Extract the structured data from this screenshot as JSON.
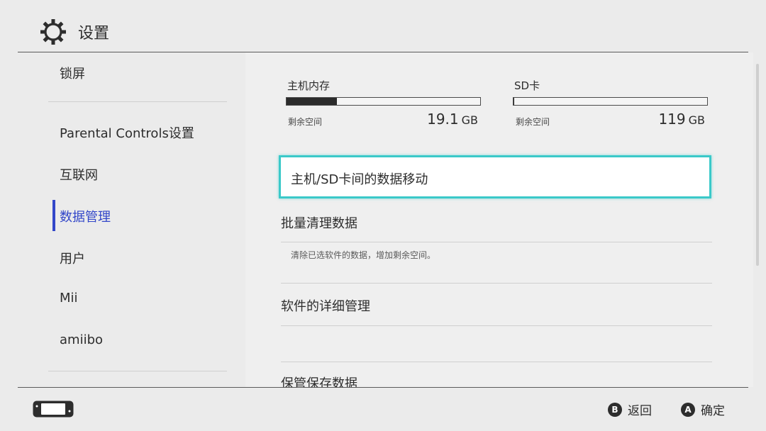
{
  "header": {
    "title": "设置",
    "icon": "gear-icon"
  },
  "sidebar": {
    "items": [
      {
        "label": "锁屏"
      },
      {
        "label": "Parental Controls设置"
      },
      {
        "label": "互联网"
      },
      {
        "label": "数据管理",
        "active": true
      },
      {
        "label": "用户"
      },
      {
        "label": "Mii"
      },
      {
        "label": "amiibo"
      }
    ]
  },
  "storage": {
    "system": {
      "label": "主机内存",
      "free_label": "剩余空间",
      "free_value": "19.1",
      "unit": "GB",
      "used_fraction": 0.26
    },
    "sd": {
      "label": "SD卡",
      "free_label": "剩余空间",
      "free_value": "119",
      "unit": "GB",
      "used_fraction": 0.005
    }
  },
  "menu": {
    "items": [
      {
        "label": "主机/SD卡间的数据移动",
        "selected": true
      },
      {
        "label": "批量清理数据",
        "description": "清除已选软件的数据，增加剩余空间。"
      },
      {
        "label": "软件的详细管理"
      },
      {
        "label": "保管保存数据"
      }
    ]
  },
  "footer": {
    "back": {
      "button": "B",
      "label": "返回"
    },
    "confirm": {
      "button": "A",
      "label": "确定"
    }
  },
  "colors": {
    "accent": "#3347c9",
    "selection": "#3bc9c9",
    "background": "#ebebeb"
  }
}
